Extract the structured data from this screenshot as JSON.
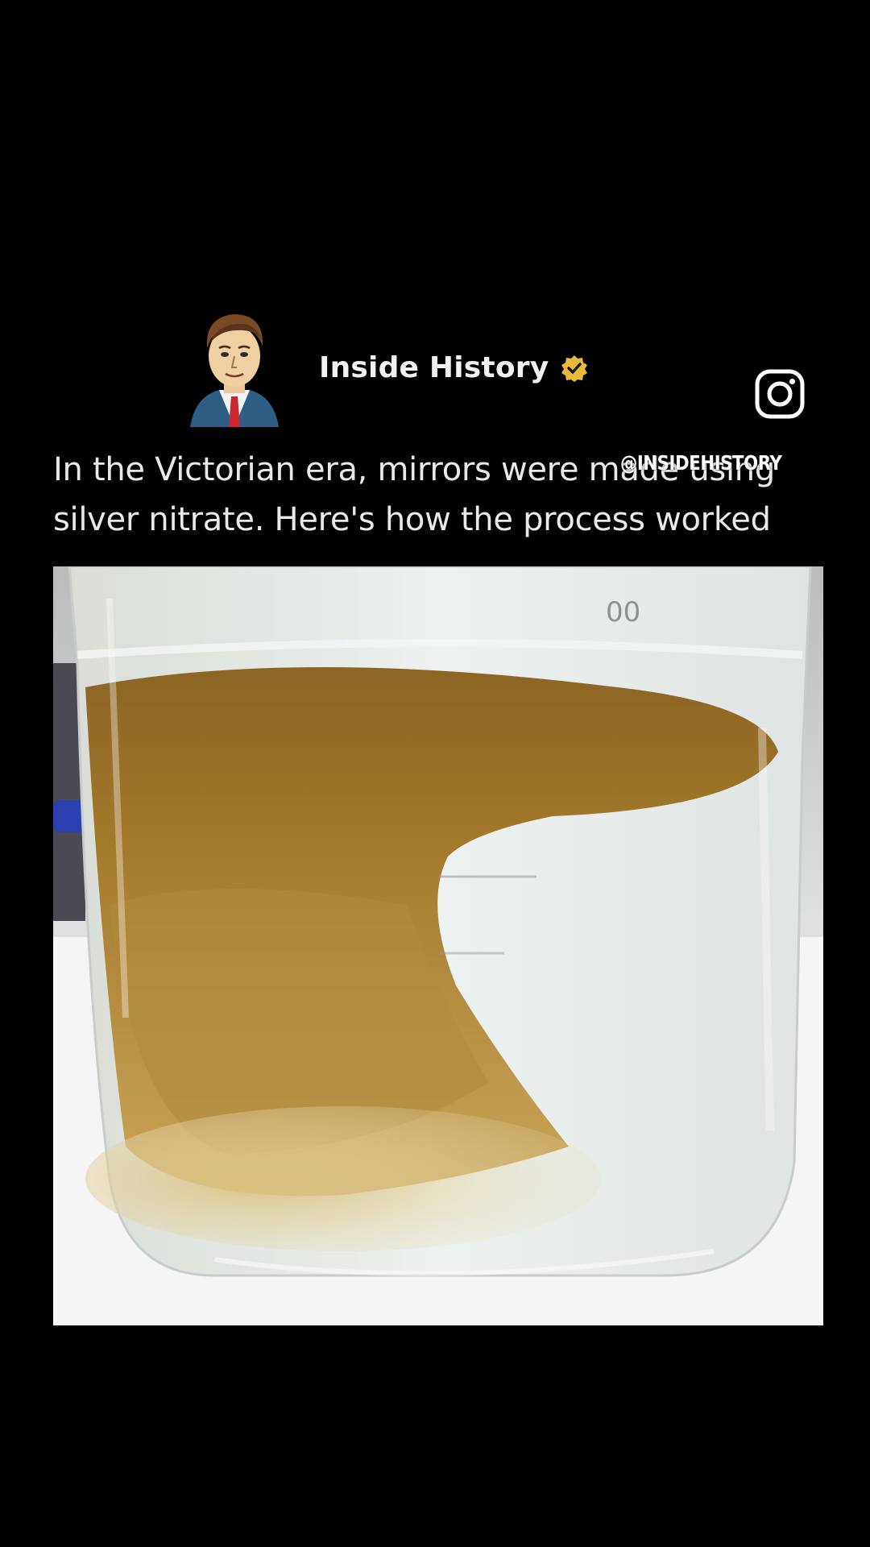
{
  "post": {
    "author_name": "Inside History",
    "verified_icon": "verified-badge-icon",
    "avatar_icon": "cartoon-portrait-avatar",
    "caption_line_1": "In the Victorian era, mirrors were made using",
    "caption_line_2": "silver nitrate. Here's how the process worked",
    "photo_scale_mark": "00"
  },
  "overlay": {
    "instagram_icon": "instagram-icon",
    "watermark": "@INSIDEHISTORY"
  },
  "colors": {
    "background": "#000000",
    "verified_badge": "#e8b93a",
    "liquid_brown": "#a57a2c",
    "water_clear": "#e6eceb"
  }
}
